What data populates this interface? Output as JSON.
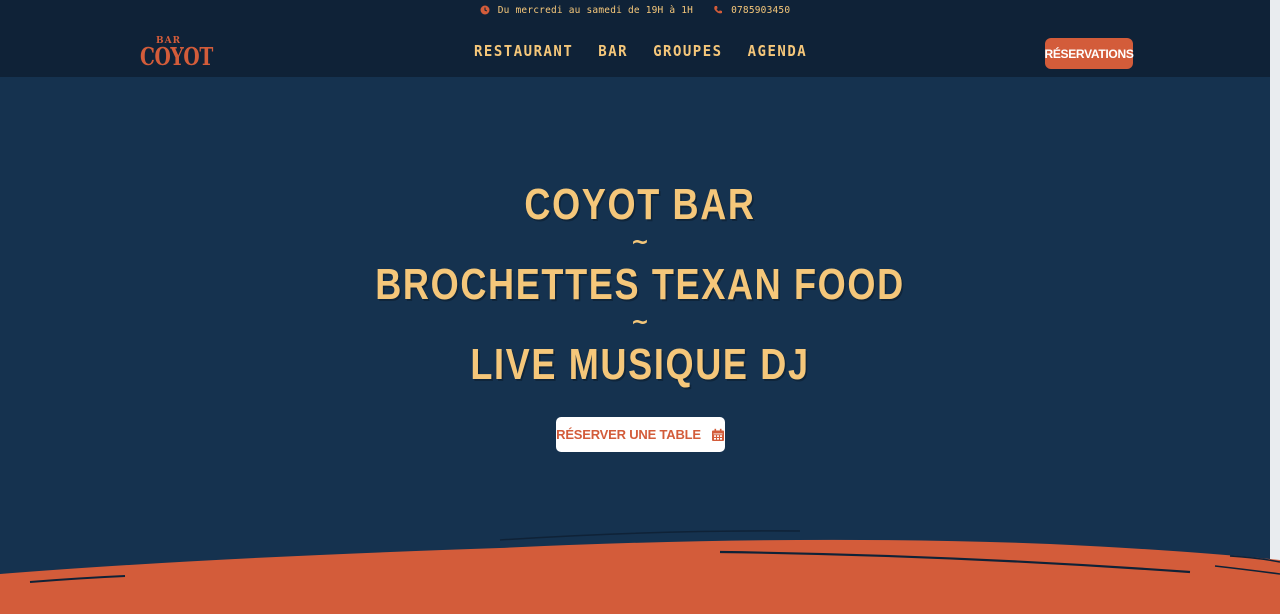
{
  "topbar": {
    "hours": "Du mercredi au samedi de 19H à 1H",
    "phone": "0785903450",
    "clock_icon": "clock-icon",
    "phone_icon": "phone-icon"
  },
  "logo": {
    "small": "BAR",
    "main": "COYOT"
  },
  "nav": {
    "items": [
      "RESTAURANT",
      "BAR",
      "GROUPES",
      "AGENDA"
    ]
  },
  "header": {
    "reservations_label": "RÉSERVATIONS"
  },
  "hero": {
    "line1": "COYOT BAR",
    "sep1": "~",
    "line2": "BROCHETTES TEXAN FOOD",
    "sep2": "~",
    "line3": "LIVE MUSIQUE DJ",
    "cta_label": "RÉSERVER UNE TABLE",
    "cta_icon": "calendar-icon"
  },
  "colors": {
    "accent": "#d35c3a",
    "gold": "#f5c77a",
    "background": "#15324f",
    "header_bg": "#0f2237"
  }
}
